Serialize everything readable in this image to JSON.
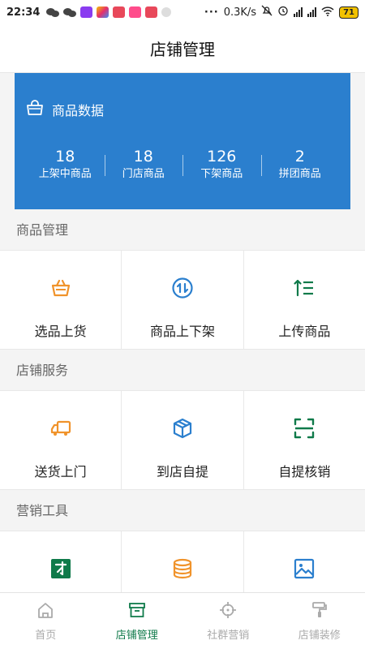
{
  "status_bar": {
    "time": "22:34",
    "speed": "0.3K/s",
    "battery": "71",
    "dots": "···"
  },
  "header": {
    "title": "店铺管理"
  },
  "data_card": {
    "title": "商品数据",
    "stats": [
      {
        "value": "18",
        "label": "上架中商品"
      },
      {
        "value": "18",
        "label": "门店商品"
      },
      {
        "value": "126",
        "label": "下架商品"
      },
      {
        "value": "2",
        "label": "拼团商品"
      }
    ]
  },
  "sections": [
    {
      "title": "商品管理",
      "items": [
        {
          "label": "选品上货",
          "icon": "basket-icon",
          "color": "#f0932b"
        },
        {
          "label": "商品上下架",
          "icon": "updown-circle-icon",
          "color": "#2b7fce"
        },
        {
          "label": "上传商品",
          "icon": "upload-list-icon",
          "color": "#0f7a4a"
        }
      ]
    },
    {
      "title": "店铺服务",
      "items": [
        {
          "label": "送货上门",
          "icon": "truck-icon",
          "color": "#f0932b"
        },
        {
          "label": "到店自提",
          "icon": "box-icon",
          "color": "#2b7fce"
        },
        {
          "label": "自提核销",
          "icon": "scan-icon",
          "color": "#0f7a4a"
        }
      ]
    },
    {
      "title": "营销工具",
      "items": [
        {
          "label": "",
          "icon": "group-buy-icon",
          "color": "#0f7a4a"
        },
        {
          "label": "",
          "icon": "database-icon",
          "color": "#f0932b"
        },
        {
          "label": "",
          "icon": "image-icon",
          "color": "#2b7fce"
        }
      ]
    }
  ],
  "bottom_nav": [
    {
      "label": "首页",
      "icon": "home-icon",
      "active": false
    },
    {
      "label": "店铺管理",
      "icon": "store-icon",
      "active": true
    },
    {
      "label": "社群营销",
      "icon": "target-icon",
      "active": false
    },
    {
      "label": "店铺装修",
      "icon": "paint-roller-icon",
      "active": false
    }
  ],
  "colors": {
    "card_blue": "#2b7fce",
    "active_green": "#0f7a4a",
    "orange": "#f0932b"
  }
}
